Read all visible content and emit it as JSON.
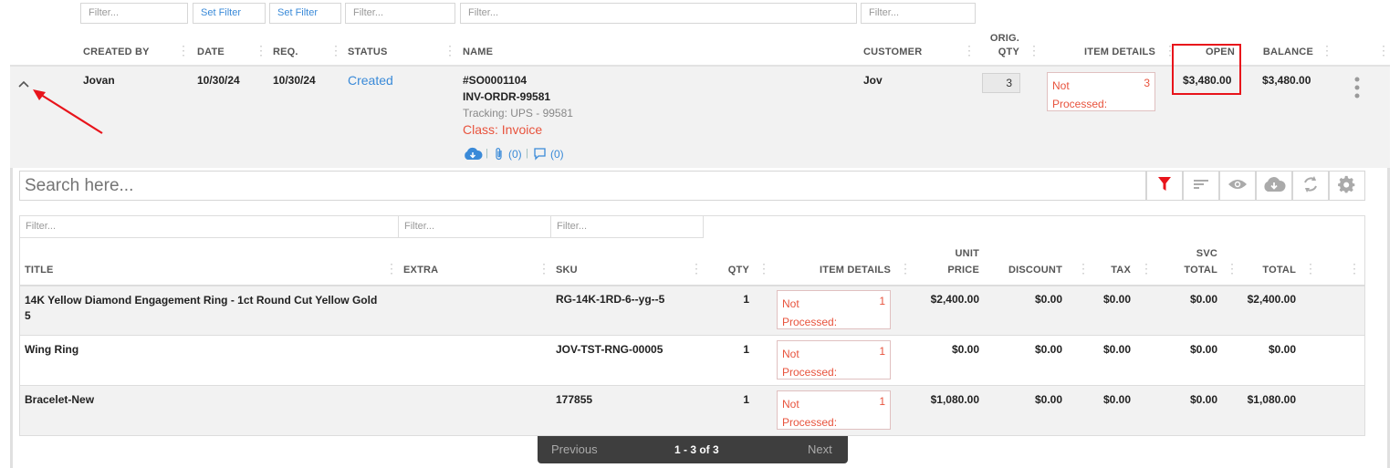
{
  "filters": {
    "created_by": "Filter...",
    "date": "Set Filter",
    "req": "Set Filter",
    "status": "Filter...",
    "name": "Filter...",
    "customer": "Filter..."
  },
  "headers": {
    "created_by": "CREATED BY",
    "date": "DATE",
    "req": "REQ.",
    "status": "STATUS",
    "name": "NAME",
    "customer": "CUSTOMER",
    "orig_qty_1": "ORIG.",
    "orig_qty_2": "QTY",
    "item_details": "ITEM DETAILS",
    "open": "OPEN",
    "balance": "BALANCE"
  },
  "order": {
    "created_by": "Jovan",
    "date": "10/30/24",
    "req": "10/30/24",
    "status": "Created",
    "so_number": "#SO0001104",
    "inv_number": "INV-ORDR-99581",
    "tracking": "Tracking: UPS - 99581",
    "class": "Class: Invoice",
    "attachments": "(0)",
    "comments": "(0)",
    "customer": "Jov",
    "orig_qty": "3",
    "item_details_label": "Not Processed:",
    "item_details_count": "3",
    "open": "$3,480.00",
    "balance": "$3,480.00"
  },
  "search": {
    "placeholder": "Search here..."
  },
  "subtable": {
    "filters": [
      "Filter...",
      "Filter...",
      "Filter..."
    ],
    "headers": {
      "title": "TITLE",
      "extra": "EXTRA",
      "sku": "SKU",
      "qty": "QTY",
      "item_details": "ITEM DETAILS",
      "unit_price_1": "UNIT",
      "unit_price_2": "PRICE",
      "discount": "DISCOUNT",
      "tax": "TAX",
      "svc_total_1": "SVC",
      "svc_total_2": "TOTAL",
      "total": "TOTAL"
    },
    "rows": [
      {
        "title": "14K Yellow Diamond Engagement Ring - 1ct Round Cut Yellow Gold 5",
        "sku": "RG-14K-1RD-6--yg--5",
        "qty": "1",
        "np_label": "Not Processed:",
        "np_count": "1",
        "unit_price": "$2,400.00",
        "discount": "$0.00",
        "tax": "$0.00",
        "svc_total": "$0.00",
        "total": "$2,400.00"
      },
      {
        "title": "Wing Ring",
        "sku": "JOV-TST-RNG-00005",
        "qty": "1",
        "np_label": "Not Processed:",
        "np_count": "1",
        "unit_price": "$0.00",
        "discount": "$0.00",
        "tax": "$0.00",
        "svc_total": "$0.00",
        "total": "$0.00"
      },
      {
        "title": "Bracelet-New",
        "sku": "177855",
        "qty": "1",
        "np_label": "Not Processed:",
        "np_count": "1",
        "unit_price": "$1,080.00",
        "discount": "$0.00",
        "tax": "$0.00",
        "svc_total": "$0.00",
        "total": "$1,080.00"
      }
    ]
  },
  "pager": {
    "previous": "Previous",
    "range": "1 - 3 of 3",
    "next": "Next"
  },
  "colors": {
    "accent_blue": "#3a8ad8",
    "status_red": "#e8533d",
    "highlight_red": "#e8141b"
  },
  "icons": [
    "chevron-up-icon",
    "red-arrow-annotation",
    "cloud-download-icon",
    "paperclip-icon",
    "comment-icon",
    "more-vertical-icon",
    "filter-icon",
    "sort-icon",
    "eye-icon",
    "cloud-download-icon",
    "refresh-icon",
    "gear-icon"
  ]
}
